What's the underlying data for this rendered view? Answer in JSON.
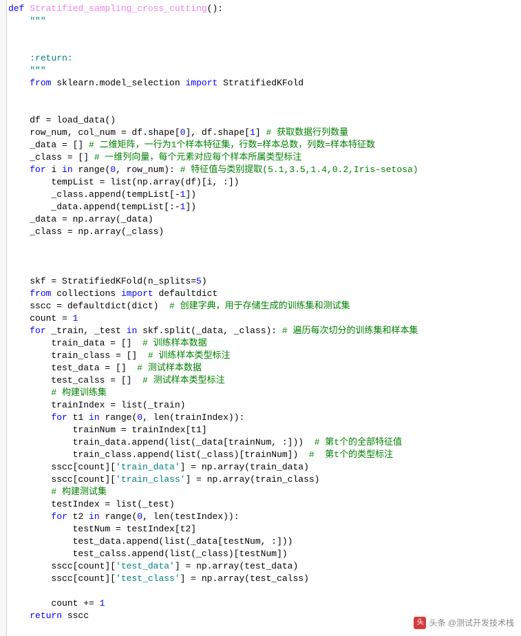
{
  "code": {
    "lines": [
      {
        "segs": [
          {
            "c": "kw",
            "t": "def "
          },
          {
            "c": "fn",
            "t": "Stratified_sampling_cross_cutting"
          },
          {
            "c": "",
            "t": "():"
          }
        ]
      },
      {
        "segs": [
          {
            "c": "",
            "t": "    "
          },
          {
            "c": "str",
            "t": "\"\"\""
          }
        ]
      },
      {
        "segs": [
          {
            "c": "",
            "t": ""
          }
        ]
      },
      {
        "segs": [
          {
            "c": "",
            "t": ""
          }
        ]
      },
      {
        "segs": [
          {
            "c": "",
            "t": "    "
          },
          {
            "c": "str",
            "t": ":return:"
          }
        ]
      },
      {
        "segs": [
          {
            "c": "",
            "t": "    "
          },
          {
            "c": "str",
            "t": "\"\"\""
          }
        ]
      },
      {
        "segs": [
          {
            "c": "",
            "t": "    "
          },
          {
            "c": "kw",
            "t": "from "
          },
          {
            "c": "",
            "t": "sklearn.model_selection "
          },
          {
            "c": "kw",
            "t": "import "
          },
          {
            "c": "",
            "t": "StratifiedKFold"
          }
        ]
      },
      {
        "segs": [
          {
            "c": "",
            "t": ""
          }
        ]
      },
      {
        "segs": [
          {
            "c": "",
            "t": ""
          }
        ]
      },
      {
        "segs": [
          {
            "c": "",
            "t": "    df = load_data()"
          }
        ]
      },
      {
        "segs": [
          {
            "c": "",
            "t": "    row_num, col_num = df.shape["
          },
          {
            "c": "num",
            "t": "0"
          },
          {
            "c": "",
            "t": "], df.shape["
          },
          {
            "c": "num",
            "t": "1"
          },
          {
            "c": "",
            "t": "] "
          },
          {
            "c": "cmt",
            "t": "# 获取数据行列数量"
          }
        ]
      },
      {
        "segs": [
          {
            "c": "",
            "t": "    _data = [] "
          },
          {
            "c": "cmt",
            "t": "# 二维矩阵，一行为1个样本特征集，行数=样本总数，列数=样本特征数"
          }
        ]
      },
      {
        "segs": [
          {
            "c": "",
            "t": "    _class = [] "
          },
          {
            "c": "cmt",
            "t": "# 一维列向量，每个元素对应每个样本所属类型标注"
          }
        ]
      },
      {
        "segs": [
          {
            "c": "",
            "t": "    "
          },
          {
            "c": "kw",
            "t": "for "
          },
          {
            "c": "",
            "t": "i "
          },
          {
            "c": "kw",
            "t": "in "
          },
          {
            "c": "",
            "t": "range("
          },
          {
            "c": "num",
            "t": "0"
          },
          {
            "c": "",
            "t": ", row_num): "
          },
          {
            "c": "cmt",
            "t": "# 特征值与类别提取(5.1,3.5,1.4,0.2,Iris-setosa)"
          }
        ]
      },
      {
        "segs": [
          {
            "c": "",
            "t": "        tempList = list(np.array(df)[i, :])"
          }
        ]
      },
      {
        "segs": [
          {
            "c": "",
            "t": "        _class.append(tempList[-"
          },
          {
            "c": "num",
            "t": "1"
          },
          {
            "c": "",
            "t": "])"
          }
        ]
      },
      {
        "segs": [
          {
            "c": "",
            "t": "        _data.append(tempList[:-"
          },
          {
            "c": "num",
            "t": "1"
          },
          {
            "c": "",
            "t": "])"
          }
        ]
      },
      {
        "segs": [
          {
            "c": "",
            "t": "    _data = np.array(_data)"
          }
        ]
      },
      {
        "segs": [
          {
            "c": "",
            "t": "    _class = np.array(_class)"
          }
        ]
      },
      {
        "segs": [
          {
            "c": "",
            "t": ""
          }
        ]
      },
      {
        "segs": [
          {
            "c": "",
            "t": ""
          }
        ]
      },
      {
        "segs": [
          {
            "c": "",
            "t": ""
          }
        ]
      },
      {
        "segs": [
          {
            "c": "",
            "t": "    skf = StratifiedKFold(n_splits="
          },
          {
            "c": "num",
            "t": "5"
          },
          {
            "c": "",
            "t": ")"
          }
        ]
      },
      {
        "segs": [
          {
            "c": "",
            "t": "    "
          },
          {
            "c": "kw",
            "t": "from "
          },
          {
            "c": "",
            "t": "collections "
          },
          {
            "c": "kw",
            "t": "import "
          },
          {
            "c": "",
            "t": "defaultdict"
          }
        ]
      },
      {
        "segs": [
          {
            "c": "",
            "t": "    sscc = defaultdict(dict)  "
          },
          {
            "c": "cmt",
            "t": "# 创建字典，用于存储生成的训练集和测试集"
          }
        ]
      },
      {
        "segs": [
          {
            "c": "",
            "t": "    count = "
          },
          {
            "c": "num",
            "t": "1"
          }
        ]
      },
      {
        "segs": [
          {
            "c": "",
            "t": "    "
          },
          {
            "c": "kw",
            "t": "for "
          },
          {
            "c": "",
            "t": "_train, _test "
          },
          {
            "c": "kw",
            "t": "in "
          },
          {
            "c": "",
            "t": "skf.split(_data, _class): "
          },
          {
            "c": "cmt",
            "t": "# 遍历每次切分的训练集和样本集"
          }
        ]
      },
      {
        "segs": [
          {
            "c": "",
            "t": "        train_data = []  "
          },
          {
            "c": "cmt",
            "t": "# 训练样本数据"
          }
        ]
      },
      {
        "segs": [
          {
            "c": "",
            "t": "        train_class = []  "
          },
          {
            "c": "cmt",
            "t": "# 训练样本类型标注"
          }
        ]
      },
      {
        "segs": [
          {
            "c": "",
            "t": "        test_data = []  "
          },
          {
            "c": "cmt",
            "t": "# 测试样本数据"
          }
        ]
      },
      {
        "segs": [
          {
            "c": "",
            "t": "        test_calss = []  "
          },
          {
            "c": "cmt",
            "t": "# 测试样本类型标注"
          }
        ]
      },
      {
        "segs": [
          {
            "c": "",
            "t": "        "
          },
          {
            "c": "cmt",
            "t": "# 构建训练集"
          }
        ]
      },
      {
        "segs": [
          {
            "c": "",
            "t": "        trainIndex = list(_train)"
          }
        ]
      },
      {
        "segs": [
          {
            "c": "",
            "t": "        "
          },
          {
            "c": "kw",
            "t": "for "
          },
          {
            "c": "",
            "t": "t1 "
          },
          {
            "c": "kw",
            "t": "in "
          },
          {
            "c": "",
            "t": "range("
          },
          {
            "c": "num",
            "t": "0"
          },
          {
            "c": "",
            "t": ", len(trainIndex)):"
          }
        ]
      },
      {
        "segs": [
          {
            "c": "",
            "t": "            trainNum = trainIndex[t1]"
          }
        ]
      },
      {
        "segs": [
          {
            "c": "",
            "t": "            train_data.append(list(_data[trainNum, :]))  "
          },
          {
            "c": "cmt",
            "t": "# 第t个的全部特征值"
          }
        ]
      },
      {
        "segs": [
          {
            "c": "",
            "t": "            train_class.append(list(_class)[trainNum])  "
          },
          {
            "c": "cmt",
            "t": "#  第t个的类型标注"
          }
        ]
      },
      {
        "segs": [
          {
            "c": "",
            "t": "        sscc[count]["
          },
          {
            "c": "str",
            "t": "'train_data'"
          },
          {
            "c": "",
            "t": "] = np.array(train_data)"
          }
        ]
      },
      {
        "segs": [
          {
            "c": "",
            "t": "        sscc[count]["
          },
          {
            "c": "str",
            "t": "'train_class'"
          },
          {
            "c": "",
            "t": "] = np.array(train_class)"
          }
        ]
      },
      {
        "segs": [
          {
            "c": "",
            "t": "        "
          },
          {
            "c": "cmt",
            "t": "# 构建测试集"
          }
        ]
      },
      {
        "segs": [
          {
            "c": "",
            "t": "        testIndex = list(_test)"
          }
        ]
      },
      {
        "segs": [
          {
            "c": "",
            "t": "        "
          },
          {
            "c": "kw",
            "t": "for "
          },
          {
            "c": "",
            "t": "t2 "
          },
          {
            "c": "kw",
            "t": "in "
          },
          {
            "c": "",
            "t": "range("
          },
          {
            "c": "num",
            "t": "0"
          },
          {
            "c": "",
            "t": ", len(testIndex)):"
          }
        ]
      },
      {
        "segs": [
          {
            "c": "",
            "t": "            testNum = testIndex[t2]"
          }
        ]
      },
      {
        "segs": [
          {
            "c": "",
            "t": "            test_data.append(list(_data[testNum, :]))"
          }
        ]
      },
      {
        "segs": [
          {
            "c": "",
            "t": "            test_calss.append(list(_class)[testNum])"
          }
        ]
      },
      {
        "segs": [
          {
            "c": "",
            "t": "        sscc[count]["
          },
          {
            "c": "str",
            "t": "'test_data'"
          },
          {
            "c": "",
            "t": "] = np.array(test_data)"
          }
        ]
      },
      {
        "segs": [
          {
            "c": "",
            "t": "        sscc[count]["
          },
          {
            "c": "str",
            "t": "'test_class'"
          },
          {
            "c": "",
            "t": "] = np.array(test_calss)"
          }
        ]
      },
      {
        "segs": [
          {
            "c": "",
            "t": ""
          }
        ]
      },
      {
        "segs": [
          {
            "c": "",
            "t": "        count += "
          },
          {
            "c": "num",
            "t": "1"
          }
        ]
      },
      {
        "segs": [
          {
            "c": "",
            "t": "    "
          },
          {
            "c": "kw",
            "t": "return "
          },
          {
            "c": "",
            "t": "sscc"
          }
        ]
      }
    ]
  },
  "watermark": {
    "logo": "头",
    "text": "头条 @测试开发技术栈"
  }
}
